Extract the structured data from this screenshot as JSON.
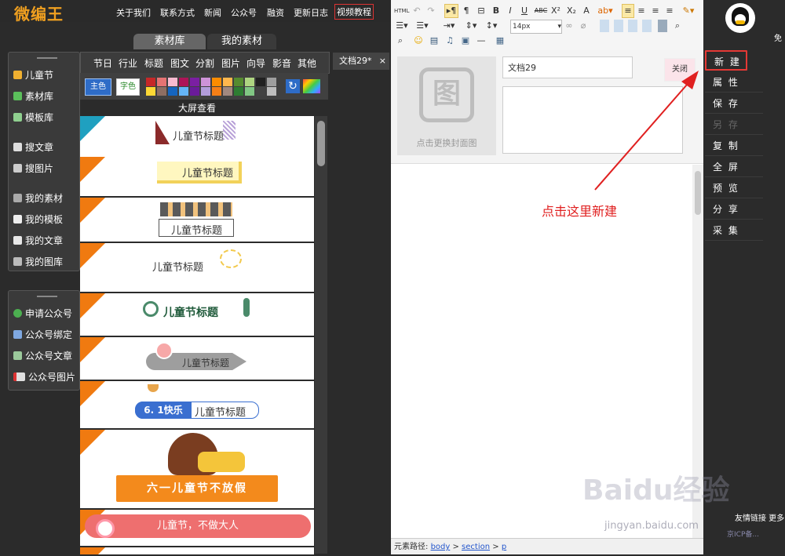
{
  "app": {
    "logo": "微编王"
  },
  "topnav": [
    "关于我们",
    "联系方式",
    "新闻",
    "公众号",
    "融资",
    "更新日志",
    "视频教程"
  ],
  "sidebar": {
    "group1": [
      "儿童节",
      "素材库",
      "模板库",
      "搜文章",
      "搜图片",
      "我的素材",
      "我的模板",
      "我的文章",
      "我的图库"
    ],
    "group2": [
      "申请公众号",
      "公众号绑定",
      "公众号文章",
      "公众号图片"
    ]
  },
  "materials": {
    "tabs": [
      "素材库",
      "我的素材"
    ],
    "categories": [
      "节日",
      "行业",
      "标题",
      "图文",
      "分割",
      "图片",
      "向导",
      "影音",
      "其他"
    ],
    "main_color_label": "主色",
    "font_color_label": "字色",
    "big_view_label": "大屏查看",
    "swatches": [
      "#c62828",
      "#e57373",
      "#f8bbd0",
      "#ad1457",
      "#7b1fa2",
      "#ce93d8",
      "#fb8c00",
      "#ffb74d",
      "#558b2f",
      "#aed581",
      "#212121",
      "#9e9e9e",
      "#fdd835",
      "#8d6e63",
      "#1565c0",
      "#64b5f6",
      "#6a1b9a",
      "#b39ddb",
      "#f57f17",
      "#a1887f",
      "#2e7d32",
      "#81c784",
      "#424242",
      "#bdbdbd"
    ],
    "cards": [
      {
        "text": "儿童节标题",
        "corner": "new"
      },
      {
        "text": "儿童节标题",
        "corner": "orange"
      },
      {
        "text": "儿童节标题",
        "corner": "orange"
      },
      {
        "text": "儿童节标题",
        "corner": "orange"
      },
      {
        "text": "儿童节标题",
        "corner": "orange"
      },
      {
        "text": "儿童节标题",
        "corner": "orange"
      },
      {
        "badge": "6. 1快乐",
        "text": "儿童节标题",
        "corner": "orange"
      },
      {
        "text": "六一儿童节不放假",
        "corner": "orange"
      },
      {
        "text": "儿童节，不做大人",
        "corner": "orange"
      }
    ]
  },
  "document_tab": {
    "label": "文档29*",
    "close": "×"
  },
  "editor": {
    "toolbar": {
      "html_label": "HTML",
      "font_size": "14px",
      "bold": "B",
      "italic": "I",
      "underline": "U",
      "strike": "ABC",
      "sup": "X²",
      "sub": "X₂",
      "font_color": "A"
    },
    "cover_caption": "点击更换封面图",
    "title_value": "文档29",
    "close_label": "关闭",
    "summary_value": "",
    "status_prefix": "元素路径:",
    "status_path": [
      "body",
      "section",
      "p"
    ]
  },
  "annotation": "点击这里新建",
  "right_menu": {
    "items": [
      "新 建",
      "属 性",
      "保 存",
      "另 存",
      "复 制",
      "全 屏",
      "预 览",
      "分 享",
      "采 集"
    ],
    "disabled_index": 3,
    "highlight_index": 0,
    "user_hint": "免",
    "footer_links": "友情链接 更多",
    "footer_note": "京ICP备..."
  },
  "watermark": {
    "main": "Baidu经验",
    "sub": "jingyan.baidu.com"
  },
  "colors": {
    "accent_orange": "#f07a10",
    "annotation_red": "#e02020",
    "highlight_border": "#e53935",
    "main_blue": "#2e6cc7"
  }
}
